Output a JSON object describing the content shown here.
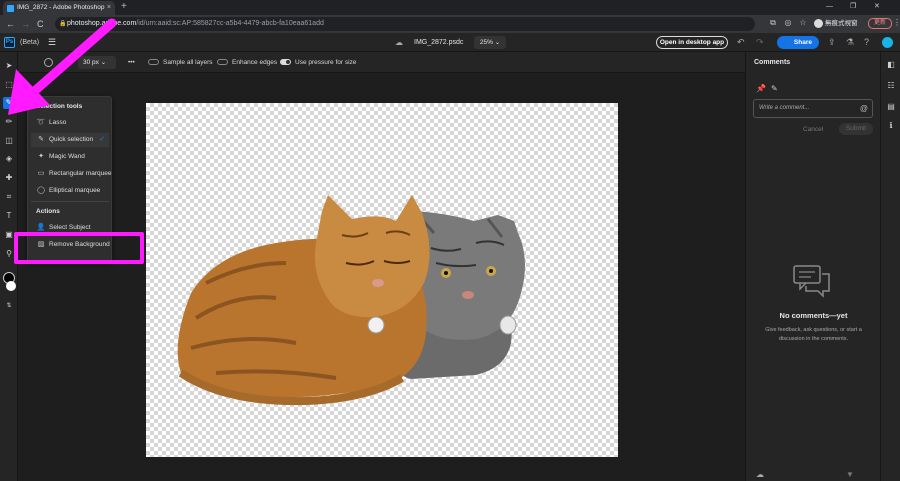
{
  "browser": {
    "tab_title": "IMG_2872 - Adobe Photoshop",
    "tab_close": "×",
    "new_tab": "+",
    "url_prefix": "photoshop.adobe.com",
    "url_rest": "/id/urn:aaid:sc:AP:585827cc-a5b4-4479-abcb-fa10eaa61add",
    "profile_name": "無痕式視窗",
    "update_label": "更新",
    "win_minimize": "—",
    "win_restore": "❐",
    "win_close": "✕",
    "nav_back": "←",
    "nav_forward": "→",
    "nav_reload": "C"
  },
  "app": {
    "logo": "Ps",
    "beta_label": "(Beta)",
    "doc_name": "IMG_2872.psdc",
    "zoom": "25%",
    "open_desktop_label": "Open in desktop app",
    "share_label": "Share"
  },
  "options_bar": {
    "brush_size": "30 px",
    "more": "•••",
    "sample_all_layers": "Sample all layers",
    "enhance_edges": "Enhance edges",
    "use_pressure": "Use pressure for size",
    "sample_all_layers_on": false,
    "enhance_edges_on": false,
    "use_pressure_on": true
  },
  "flyout": {
    "section_tools": "Selection tools",
    "tools": [
      {
        "label": "Lasso",
        "icon": "lasso-icon",
        "checked": false
      },
      {
        "label": "Quick selection",
        "icon": "quick-selection-icon",
        "checked": true
      },
      {
        "label": "Magic Wand",
        "icon": "magic-wand-icon",
        "checked": false
      },
      {
        "label": "Rectangular marquee",
        "icon": "rectangular-marquee-icon",
        "checked": false
      },
      {
        "label": "Elliptical marquee",
        "icon": "elliptical-marquee-icon",
        "checked": false
      }
    ],
    "section_actions": "Actions",
    "actions": [
      {
        "label": "Select Subject",
        "icon": "select-subject-icon"
      },
      {
        "label": "Remove Background",
        "icon": "remove-background-icon"
      }
    ],
    "check_mark": "✓"
  },
  "comments": {
    "title": "Comments",
    "placeholder": "Write a comment...",
    "at_symbol": "@",
    "cancel_label": "Cancel",
    "submit_label": "Submit",
    "empty_title": "No comments—yet",
    "empty_text": "Give feedback, ask questions, or start a discussion in the comments."
  },
  "colors": {
    "accent": "#1473e6",
    "annotation": "#ff1aff",
    "panel_bg": "#252525",
    "canvas_bg": "#1e1e1e"
  }
}
